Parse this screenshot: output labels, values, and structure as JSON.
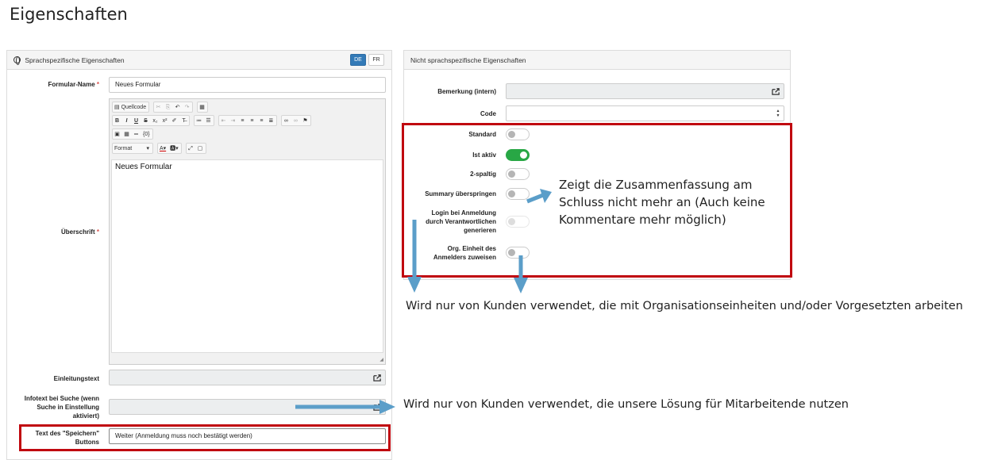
{
  "page_title": "Eigenschaften",
  "left_panel": {
    "title": "Sprachspezifische Eigenschaften",
    "lang_de": "DE",
    "lang_fr": "FR",
    "formular_name_label": "Formular-Name",
    "required_mark": "*",
    "formular_name_value": "Neues Formular",
    "ueberschrift_label": "Überschrift",
    "editor": {
      "source_label": "Quellcode",
      "format_label": "Format",
      "content": "Neues Formular"
    },
    "einleitungstext_label": "Einleitungstext",
    "infotext_label": "Infotext bei Suche (wenn Suche in Einstellung aktiviert)",
    "speichern_label": "Text des \"Speichern\" Buttons",
    "speichern_value": "Weiter (Anmeldung muss noch bestätigt werden)"
  },
  "right_panel": {
    "title": "Nicht sprachspezifische Eigenschaften",
    "bemerkung_label": "Bemerkung (intern)",
    "code_label": "Code",
    "toggles": [
      {
        "label": "Standard",
        "on": false
      },
      {
        "label": "Ist aktiv",
        "on": true
      },
      {
        "label": "2-spaltig",
        "on": false
      },
      {
        "label": "Summary überspringen",
        "on": false
      },
      {
        "label": "Login bei Anmeldung durch Verantwortlichen generieren",
        "on": false
      },
      {
        "label": "Org. Einheit des Anmelders zuweisen",
        "on": false
      }
    ]
  },
  "annotations": {
    "summary_note": "Zeigt die Zusammenfassung am Schluss nicht mehr an (Auch keine Kommentare mehr möglich)",
    "org_note": "Wird nur von Kunden verwendet, die mit Organisationseinheiten und/oder Vorgesetzten arbeiten",
    "infotext_note": "Wird nur von Kunden verwendet, die unsere Lösung für Mitarbeitende nutzen"
  },
  "colors": {
    "highlight": "#c0070f",
    "arrow": "#5b9ec9",
    "toggle_on": "#28a745",
    "lang_active": "#337ab7"
  }
}
